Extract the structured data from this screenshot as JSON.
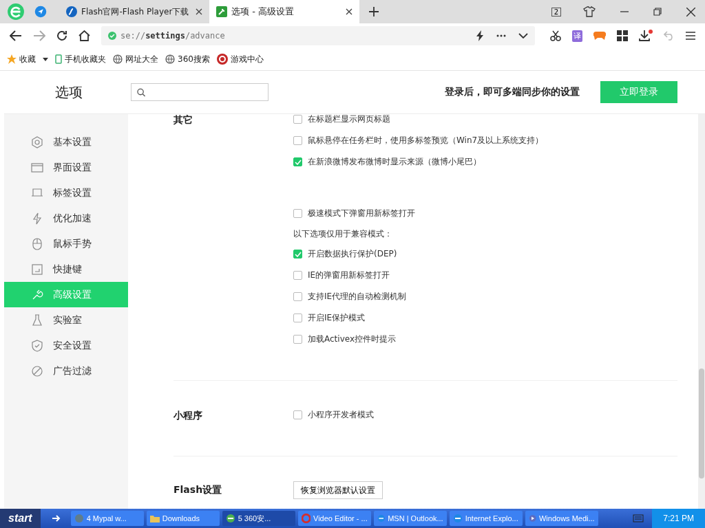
{
  "browser": {
    "tabs": [
      {
        "title": "Flash官网-Flash Player下载",
        "selected": false,
        "kind": "flash"
      },
      {
        "title": "选项 - 高级设置",
        "selected": true,
        "kind": "wrench"
      }
    ],
    "tab_count": "2",
    "address": {
      "scheme": "se://",
      "host": "settings",
      "path": "/advance"
    },
    "bookmarks": [
      {
        "label": "收藏",
        "kind": "star"
      },
      {
        "label": "手机收藏夹",
        "kind": "phone"
      },
      {
        "label": "网址大全",
        "kind": "globe"
      },
      {
        "label": "360搜索",
        "kind": "globe"
      },
      {
        "label": "游戏中心",
        "kind": "game"
      }
    ],
    "translate_label": "译"
  },
  "settings": {
    "title": "选项",
    "login_prompt": "登录后，即可多端同步你的设置",
    "login_button": "立即登录",
    "sidebar": [
      {
        "label": "基本设置",
        "kind": "gear",
        "selected": false
      },
      {
        "label": "界面设置",
        "kind": "window",
        "selected": false
      },
      {
        "label": "标签设置",
        "kind": "tab",
        "selected": false
      },
      {
        "label": "优化加速",
        "kind": "bolt",
        "selected": false
      },
      {
        "label": "鼠标手势",
        "kind": "mouse",
        "selected": false
      },
      {
        "label": "快捷键",
        "kind": "key",
        "selected": false
      },
      {
        "label": "高级设置",
        "kind": "wrench",
        "selected": true
      },
      {
        "label": "实验室",
        "kind": "flask",
        "selected": false
      },
      {
        "label": "安全设置",
        "kind": "shield",
        "selected": false
      },
      {
        "label": "广告过滤",
        "kind": "block",
        "selected": false
      }
    ],
    "sections": [
      {
        "heading": "其它",
        "items": [
          {
            "kind": "checkbox",
            "label": "在标题栏显示网页标题",
            "checked": false
          },
          {
            "kind": "checkbox",
            "label": "鼠标悬停在任务栏时，使用多标签预览（Win7及以上系统支持）",
            "checked": false
          },
          {
            "kind": "checkbox",
            "label": "在新浪微博发布微博时显示来源（微博小尾巴）",
            "checked": true
          },
          {
            "kind": "spacer"
          },
          {
            "kind": "checkbox",
            "label": "极速模式下弹窗用新标签打开",
            "checked": false
          },
          {
            "kind": "note",
            "label": "以下选项仅用于兼容模式："
          },
          {
            "kind": "checkbox",
            "label": "开启数据执行保护(DEP)",
            "checked": true
          },
          {
            "kind": "checkbox",
            "label": "IE的弹窗用新标签打开",
            "checked": false
          },
          {
            "kind": "checkbox",
            "label": "支持IE代理的自动检测机制",
            "checked": false
          },
          {
            "kind": "checkbox",
            "label": "开启IE保护模式",
            "checked": false
          },
          {
            "kind": "checkbox",
            "label": "加载Activex控件时提示",
            "checked": false
          }
        ]
      },
      {
        "heading": "小程序",
        "items": [
          {
            "kind": "checkbox",
            "label": "小程序开发者模式",
            "checked": false
          }
        ]
      },
      {
        "heading": "Flash设置",
        "items": [
          {
            "kind": "button",
            "label": "恢复浏览器默认设置"
          }
        ]
      }
    ]
  },
  "taskbar": {
    "start": "start",
    "items": [
      {
        "label": "4 Mypal w...",
        "selected": false,
        "kind": "raccoon"
      },
      {
        "label": "Downloads",
        "selected": false,
        "kind": "folder"
      },
      {
        "label": "5 360安...",
        "selected": true,
        "kind": "e"
      },
      {
        "label": "Video Editor - ...",
        "selected": false,
        "kind": "opera"
      },
      {
        "label": "MSN | Outlook...",
        "selected": false,
        "kind": "ie"
      },
      {
        "label": "Internet Explo...",
        "selected": false,
        "kind": "ie"
      },
      {
        "label": "Windows Medi...",
        "selected": false,
        "kind": "media"
      }
    ],
    "clock": "7:21 PM"
  }
}
